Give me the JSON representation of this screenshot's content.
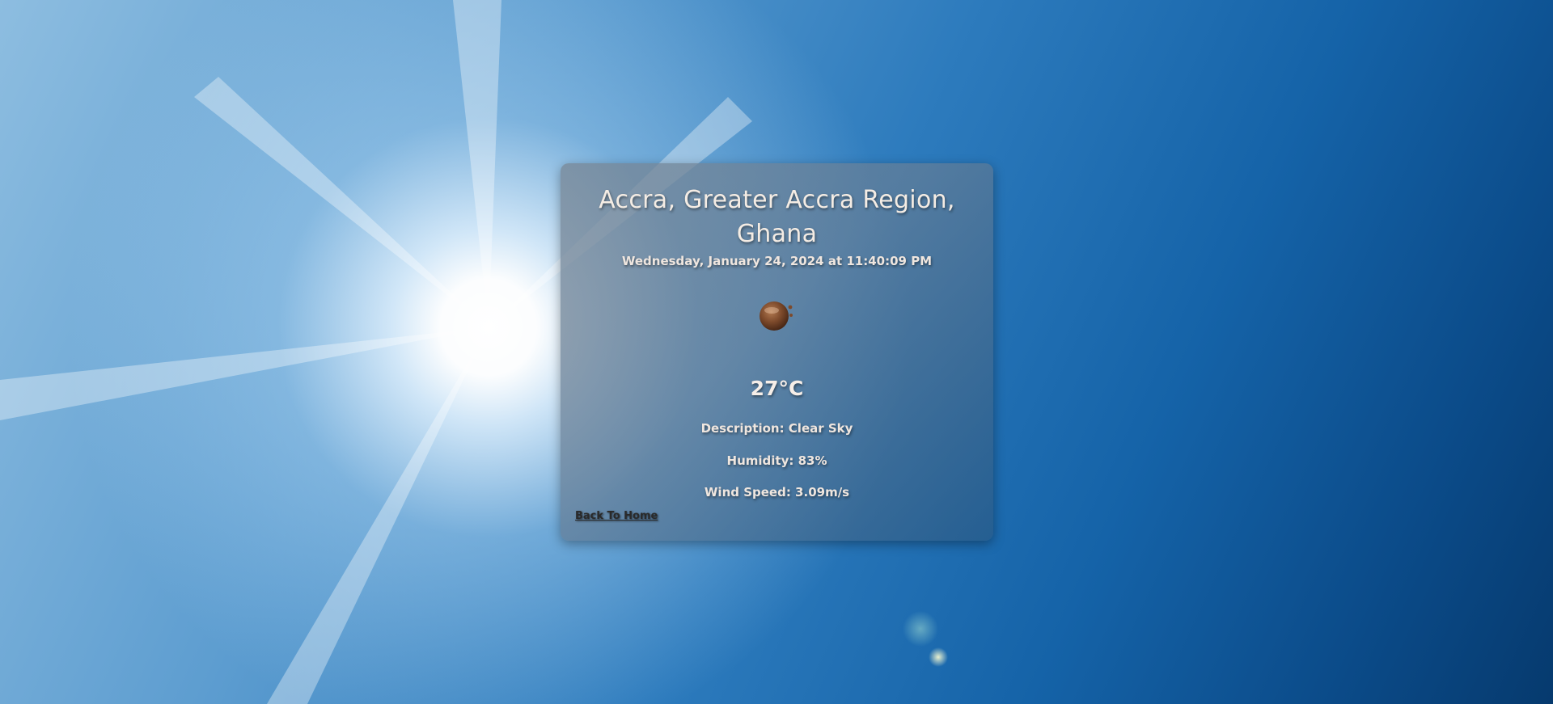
{
  "location": {
    "title": "Accra, Greater Accra Region, Ghana"
  },
  "datetime": "Wednesday, January 24, 2024 at 11:40:09 PM",
  "weather": {
    "icon": "clear-night-moon-icon",
    "temperature": "27°C",
    "description": "Description: Clear Sky",
    "humidity": "Humidity: 83%",
    "wind_speed": "Wind Speed: 3.09m/s"
  },
  "navigation": {
    "back_label": "Back To Home"
  },
  "colors": {
    "card_tint": "#5e7f9a",
    "text": "#f3ece6",
    "icon_brown": "#7a4a2c",
    "sky_blue": "#1f6aa8"
  }
}
